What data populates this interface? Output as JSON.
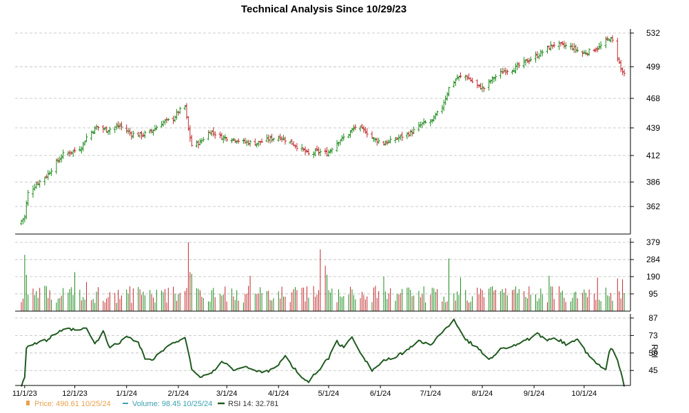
{
  "title": "Technical Analysis Since 10/29/23",
  "legend": {
    "price": {
      "label": "Price: 490.61  10/25/24",
      "color": "#e8a04a"
    },
    "volume": {
      "label": "Volume: 98.45  10/25/24",
      "color": "#3aa0b0"
    },
    "rsi": {
      "label": "RSI 14: 32.781",
      "color": "#1f5a1f"
    }
  },
  "colors": {
    "up": "#1a8a1a",
    "down": "#c0282a",
    "rsi": "#1f5a1f",
    "grid": "#bbbbbb"
  },
  "rsi_axis_label": "RSI",
  "chart_data": [
    {
      "type": "ohlc",
      "title": "Technical Analysis Since 10/29/23",
      "ylim": [
        335,
        532
      ],
      "yticks": [
        "362",
        "386",
        "412",
        "439",
        "468",
        "499",
        "532"
      ],
      "xticks": [
        "11/1/23",
        "12/1/23",
        "1/1/24",
        "2/1/24",
        "3/1/24",
        "4/1/24",
        "5/1/24",
        "6/1/24",
        "7/1/24",
        "8/1/24",
        "9/1/24",
        "10/1/24"
      ],
      "date_range": [
        "2023-10-30",
        "2024-10-25"
      ],
      "close_anchors": [
        [
          "2023-10-30",
          348
        ],
        [
          "2023-11-01",
          352
        ],
        [
          "2023-11-02",
          365
        ],
        [
          "2023-11-03",
          375
        ],
        [
          "2023-11-08",
          384
        ],
        [
          "2023-11-14",
          392
        ],
        [
          "2023-11-20",
          405
        ],
        [
          "2023-11-24",
          413
        ],
        [
          "2023-11-30",
          416
        ],
        [
          "2023-12-05",
          420
        ],
        [
          "2023-12-08",
          430
        ],
        [
          "2023-12-14",
          440
        ],
        [
          "2023-12-20",
          437
        ],
        [
          "2023-12-28",
          441
        ],
        [
          "2024-01-04",
          433
        ],
        [
          "2024-01-10",
          432
        ],
        [
          "2024-01-16",
          436
        ],
        [
          "2024-01-22",
          444
        ],
        [
          "2024-01-29",
          448
        ],
        [
          "2024-02-01",
          455
        ],
        [
          "2024-02-05",
          460
        ],
        [
          "2024-02-07",
          437
        ],
        [
          "2024-02-09",
          422
        ],
        [
          "2024-02-14",
          425
        ],
        [
          "2024-02-20",
          436
        ],
        [
          "2024-02-27",
          430
        ],
        [
          "2024-03-05",
          428
        ],
        [
          "2024-03-12",
          425
        ],
        [
          "2024-03-19",
          424
        ],
        [
          "2024-03-26",
          428
        ],
        [
          "2024-04-02",
          430
        ],
        [
          "2024-04-08",
          425
        ],
        [
          "2024-04-15",
          418
        ],
        [
          "2024-04-19",
          413
        ],
        [
          "2024-04-24",
          416
        ],
        [
          "2024-04-30",
          414
        ],
        [
          "2024-05-06",
          425
        ],
        [
          "2024-05-13",
          433
        ],
        [
          "2024-05-17",
          440
        ],
        [
          "2024-05-23",
          436
        ],
        [
          "2024-05-28",
          428
        ],
        [
          "2024-06-03",
          424
        ],
        [
          "2024-06-07",
          426
        ],
        [
          "2024-06-13",
          430
        ],
        [
          "2024-06-20",
          435
        ],
        [
          "2024-06-26",
          443
        ],
        [
          "2024-07-02",
          446
        ],
        [
          "2024-07-08",
          460
        ],
        [
          "2024-07-12",
          478
        ],
        [
          "2024-07-17",
          488
        ],
        [
          "2024-07-22",
          490
        ],
        [
          "2024-07-29",
          480
        ],
        [
          "2024-08-02",
          478
        ],
        [
          "2024-08-07",
          487
        ],
        [
          "2024-08-14",
          495
        ],
        [
          "2024-08-20",
          497
        ],
        [
          "2024-08-26",
          503
        ],
        [
          "2024-09-03",
          510
        ],
        [
          "2024-09-09",
          517
        ],
        [
          "2024-09-13",
          521
        ],
        [
          "2024-09-18",
          520
        ],
        [
          "2024-09-24",
          518
        ],
        [
          "2024-09-30",
          512
        ],
        [
          "2024-10-04",
          514
        ],
        [
          "2024-10-10",
          518
        ],
        [
          "2024-10-16",
          527
        ],
        [
          "2024-10-18",
          524
        ],
        [
          "2024-10-21",
          509
        ],
        [
          "2024-10-23",
          497
        ],
        [
          "2024-10-25",
          490.61
        ]
      ]
    },
    {
      "type": "bar",
      "ylim": [
        0,
        379
      ],
      "yticks": [
        "95",
        "190",
        "284",
        "379"
      ],
      "volume_spikes": [
        [
          "2023-11-01",
          310
        ],
        [
          "2023-11-02",
          200
        ],
        [
          "2023-12-01",
          215
        ],
        [
          "2023-12-08",
          160
        ],
        [
          "2024-02-07",
          379
        ],
        [
          "2024-02-08",
          215
        ],
        [
          "2024-02-09",
          205
        ],
        [
          "2024-03-15",
          195
        ],
        [
          "2024-04-26",
          340
        ],
        [
          "2024-04-29",
          250
        ],
        [
          "2024-04-30",
          200
        ],
        [
          "2024-06-03",
          190
        ],
        [
          "2024-07-12",
          290
        ],
        [
          "2024-07-19",
          185
        ],
        [
          "2024-09-10",
          195
        ],
        [
          "2024-10-09",
          185
        ],
        [
          "2024-10-21",
          180
        ],
        [
          "2024-10-24",
          175
        ],
        [
          "2024-10-25",
          98.45
        ]
      ]
    },
    {
      "type": "line",
      "ylim": [
        33,
        87
      ],
      "yticks": [
        "45",
        "59",
        "73",
        "87"
      ],
      "ylabel": "RSI",
      "rsi_anchors": [
        [
          "2023-10-30",
          33
        ],
        [
          "2023-11-01",
          40
        ],
        [
          "2023-11-02",
          64
        ],
        [
          "2023-11-08",
          67
        ],
        [
          "2023-11-14",
          69
        ],
        [
          "2023-11-20",
          75
        ],
        [
          "2023-11-27",
          78
        ],
        [
          "2023-12-04",
          77
        ],
        [
          "2023-12-08",
          79
        ],
        [
          "2023-12-13",
          66
        ],
        [
          "2023-12-18",
          76
        ],
        [
          "2023-12-22",
          63
        ],
        [
          "2024-01-02",
          72
        ],
        [
          "2024-01-08",
          68
        ],
        [
          "2024-01-12",
          55
        ],
        [
          "2024-01-16",
          53
        ],
        [
          "2024-01-22",
          60
        ],
        [
          "2024-01-29",
          67
        ],
        [
          "2024-02-05",
          72
        ],
        [
          "2024-02-07",
          60
        ],
        [
          "2024-02-09",
          45
        ],
        [
          "2024-02-13",
          40
        ],
        [
          "2024-02-20",
          42
        ],
        [
          "2024-02-27",
          52
        ],
        [
          "2024-03-05",
          46
        ],
        [
          "2024-03-12",
          48
        ],
        [
          "2024-03-19",
          44
        ],
        [
          "2024-03-26",
          45
        ],
        [
          "2024-04-01",
          50
        ],
        [
          "2024-04-05",
          56
        ],
        [
          "2024-04-10",
          47
        ],
        [
          "2024-04-16",
          38
        ],
        [
          "2024-04-19",
          36
        ],
        [
          "2024-04-24",
          44
        ],
        [
          "2024-05-01",
          55
        ],
        [
          "2024-05-06",
          68
        ],
        [
          "2024-05-10",
          63
        ],
        [
          "2024-05-15",
          72
        ],
        [
          "2024-05-20",
          60
        ],
        [
          "2024-05-27",
          45
        ],
        [
          "2024-06-03",
          53
        ],
        [
          "2024-06-10",
          55
        ],
        [
          "2024-06-17",
          62
        ],
        [
          "2024-06-24",
          68
        ],
        [
          "2024-07-01",
          66
        ],
        [
          "2024-07-08",
          75
        ],
        [
          "2024-07-15",
          86
        ],
        [
          "2024-07-22",
          70
        ],
        [
          "2024-07-29",
          63
        ],
        [
          "2024-08-05",
          54
        ],
        [
          "2024-08-12",
          62
        ],
        [
          "2024-08-19",
          65
        ],
        [
          "2024-08-26",
          68
        ],
        [
          "2024-09-03",
          74
        ],
        [
          "2024-09-09",
          68
        ],
        [
          "2024-09-13",
          72
        ],
        [
          "2024-09-20",
          66
        ],
        [
          "2024-09-27",
          70
        ],
        [
          "2024-10-04",
          56
        ],
        [
          "2024-10-09",
          50
        ],
        [
          "2024-10-14",
          45
        ],
        [
          "2024-10-16",
          60
        ],
        [
          "2024-10-18",
          63
        ],
        [
          "2024-10-21",
          52
        ],
        [
          "2024-10-23",
          45
        ],
        [
          "2024-10-25",
          32.781
        ]
      ]
    }
  ]
}
